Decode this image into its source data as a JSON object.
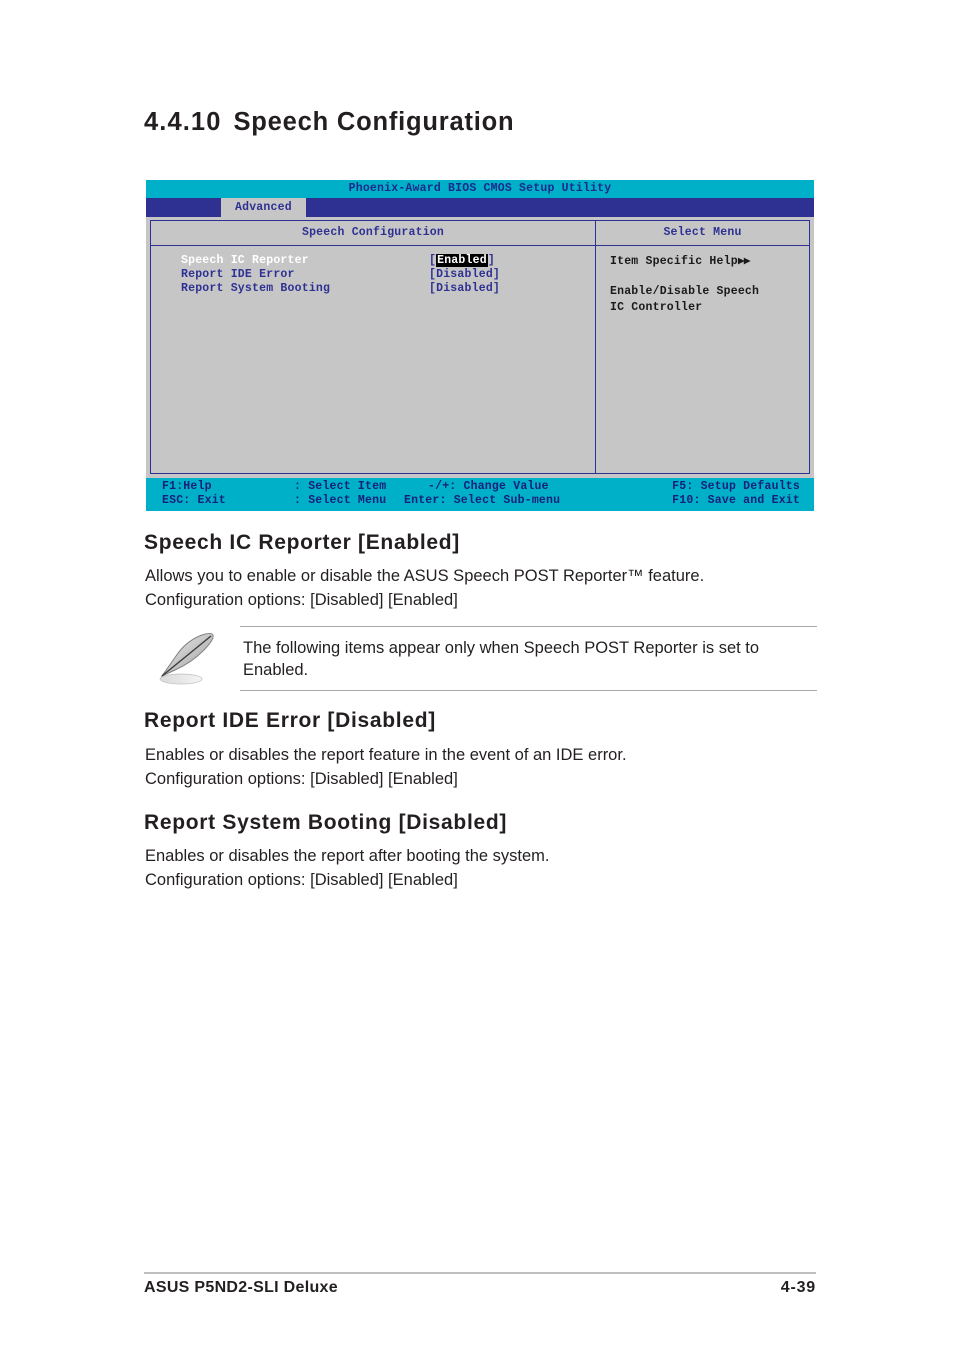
{
  "section": {
    "number": "4.4.10",
    "title": "Speech Configuration"
  },
  "bios": {
    "titlebar": "Phoenix-Award BIOS CMOS Setup Utility",
    "active_tab": "Advanced",
    "left_panel_header": "Speech Configuration",
    "right_panel_header": "Select Menu",
    "options": [
      {
        "label": "Speech IC Reporter",
        "value": "Enabled",
        "selected": true
      },
      {
        "label": "Report IDE Error",
        "value": "Disabled",
        "selected": false
      },
      {
        "label": "Report System Booting",
        "value": "Disabled",
        "selected": false
      }
    ],
    "help": {
      "title": "Item Specific Help",
      "arrows": "▶▶",
      "line1": "Enable/Disable Speech",
      "line2": "IC Controller"
    },
    "footer": {
      "row1": {
        "c1": "F1:Help",
        "c2": ":  Select Item",
        "c3": "-/+: Change Value",
        "c4": "F5: Setup Defaults"
      },
      "row2": {
        "c1": "ESC: Exit",
        "c2": ":  Select Menu",
        "c3": "Enter: Select Sub-menu",
        "c4": "F10: Save and Exit"
      }
    },
    "colors": {
      "titlebar_bg": "#00b0c8",
      "menubar_bg": "#2e3192",
      "panel_bg": "#c6c6c6",
      "border": "#2e3192",
      "label": "#2e3192",
      "selected_label": "#ffffff",
      "highlight_bg": "#000000"
    }
  },
  "sections": [
    {
      "heading": "Speech IC Reporter [Enabled]",
      "line1": "Allows you to enable or disable  the ASUS Speech POST Reporter™ feature.",
      "line2": "Configuration options: [Disabled] [Enabled]"
    },
    {
      "heading": "Report IDE Error [Disabled]",
      "line1": "Enables or disables the report feature in the event of an IDE error.",
      "line2": "Configuration options: [Disabled] [Enabled]"
    },
    {
      "heading": "Report System Booting [Disabled]",
      "line1": "Enables or disables the report after booting the system.",
      "line2": "Configuration options: [Disabled] [Enabled]"
    }
  ],
  "note": {
    "icon": "pencil-note-icon",
    "line1": "The following items appear only when Speech POST Reporter is set to",
    "line2": "Enabled."
  },
  "page_footer": {
    "product": "ASUS P5ND2-SLI Deluxe",
    "page_number": "4-39"
  }
}
